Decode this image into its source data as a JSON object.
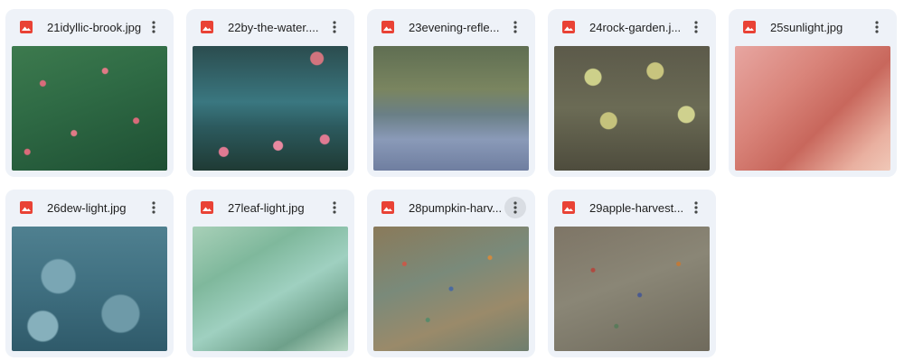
{
  "colors": {
    "card_background": "#eef2f8",
    "image_icon": "#e94235",
    "text": "#1f1f1f"
  },
  "files": [
    {
      "name": "21idyllic-brook.jpg",
      "icon": "image-file-icon"
    },
    {
      "name": "22by-the-water....",
      "icon": "image-file-icon"
    },
    {
      "name": "23evening-refle...",
      "icon": "image-file-icon"
    },
    {
      "name": "24rock-garden.j...",
      "icon": "image-file-icon"
    },
    {
      "name": "25sunlight.jpg",
      "icon": "image-file-icon"
    },
    {
      "name": "26dew-light.jpg",
      "icon": "image-file-icon"
    },
    {
      "name": "27leaf-light.jpg",
      "icon": "image-file-icon"
    },
    {
      "name": "28pumpkin-harv...",
      "icon": "image-file-icon"
    },
    {
      "name": "29apple-harvest...",
      "icon": "image-file-icon"
    }
  ]
}
